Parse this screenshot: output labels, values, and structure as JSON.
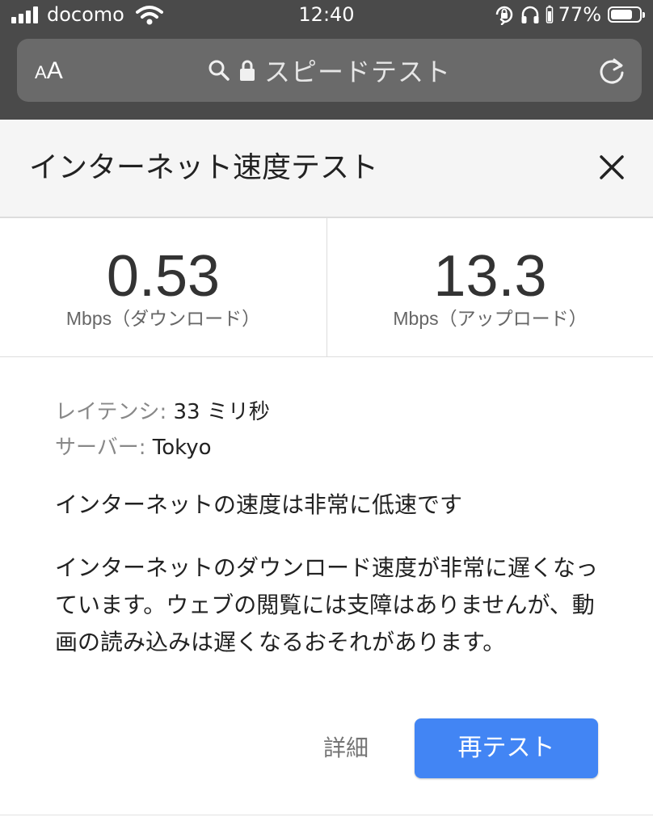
{
  "status_bar": {
    "carrier": "docomo",
    "time": "12:40",
    "battery_percent": "77%",
    "battery_level": 0.77,
    "icons": [
      "signal-icon",
      "wifi-icon",
      "orientation-lock-icon",
      "headphones-icon",
      "battery-icon"
    ]
  },
  "browser": {
    "text_size_small": "A",
    "text_size_big": "A",
    "url_title": "スピードテスト",
    "icons": [
      "search-icon",
      "lock-icon",
      "reload-icon"
    ]
  },
  "card": {
    "title": "インターネット速度テスト",
    "download": {
      "value": "0.53",
      "unit": "Mbps",
      "label": "（ダウンロード）"
    },
    "upload": {
      "value": "13.3",
      "unit": "Mbps",
      "label": "（アップロード）"
    },
    "latency": {
      "label": "レイテンシ:",
      "value": "33 ミリ秒"
    },
    "server": {
      "label": "サーバー:",
      "value": "Tokyo"
    },
    "summary": "インターネットの速度は非常に低速です",
    "description": "インターネットのダウンロード速度が非常に遅くなっています。ウェブの閲覧には支障はありませんが、動画の読み込みは遅くなるおそれがあります。",
    "details_label": "詳細",
    "retest_label": "再テスト"
  },
  "colors": {
    "chrome_bg": "#4a4a4a",
    "urlbar_bg": "#6a6a6a",
    "accent": "#4285f4"
  }
}
